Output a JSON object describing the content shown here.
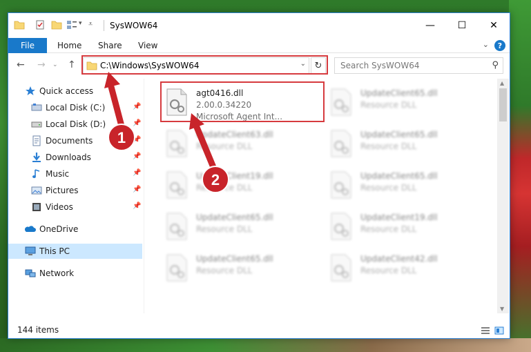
{
  "window": {
    "title": "SysWOW64",
    "minimize": "—",
    "maximize": "☐",
    "close": "✕"
  },
  "ribbon": {
    "file": "File",
    "home": "Home",
    "share": "Share",
    "view": "View",
    "help": "?"
  },
  "address": {
    "path": "C:\\Windows\\SysWOW64",
    "search_placeholder": "Search SysWOW64"
  },
  "nav": {
    "items": [
      {
        "label": "Quick access",
        "icon": "star-icon"
      },
      {
        "label": "Local Disk (C:)",
        "icon": "drive-icon"
      },
      {
        "label": "Local Disk (D:)",
        "icon": "drive-icon"
      },
      {
        "label": "Documents",
        "icon": "documents-icon"
      },
      {
        "label": "Downloads",
        "icon": "downloads-icon"
      },
      {
        "label": "Music",
        "icon": "music-icon"
      },
      {
        "label": "Pictures",
        "icon": "pictures-icon"
      },
      {
        "label": "Videos",
        "icon": "videos-icon"
      },
      {
        "label": "OneDrive",
        "icon": "onedrive-icon"
      },
      {
        "label": "This PC",
        "icon": "this-pc-icon"
      },
      {
        "label": "Network",
        "icon": "network-icon"
      }
    ]
  },
  "files": [
    {
      "name": "agt0416.dll",
      "line1": "2.00.0.34220",
      "line2": "Microsoft Agent Int..."
    },
    {
      "name": "UpdateClient65.dll",
      "line1": "Resource DLL"
    },
    {
      "name": "UpdateClient63.dll",
      "line1": "Resource DLL"
    },
    {
      "name": "UpdateClient65.dll",
      "line1": "Resource DLL"
    },
    {
      "name": "UpdateClient19.dll",
      "line1": "Resource DLL"
    },
    {
      "name": "UpdateClient65.dll",
      "line1": "Resource DLL"
    },
    {
      "name": "UpdateClient65.dll",
      "line1": "Resource DLL"
    },
    {
      "name": "UpdateClient19.dll",
      "line1": "Resource DLL"
    },
    {
      "name": "UpdateClient65.dll",
      "line1": "Resource DLL"
    },
    {
      "name": "UpdateClient42.dll",
      "line1": "Resource DLL"
    }
  ],
  "status": {
    "count": "144 items"
  },
  "annotations": {
    "step1": "1",
    "step2": "2"
  },
  "colors": {
    "accent": "#1979ca",
    "highlight": "#d63a3e",
    "selected": "#cce8ff"
  }
}
